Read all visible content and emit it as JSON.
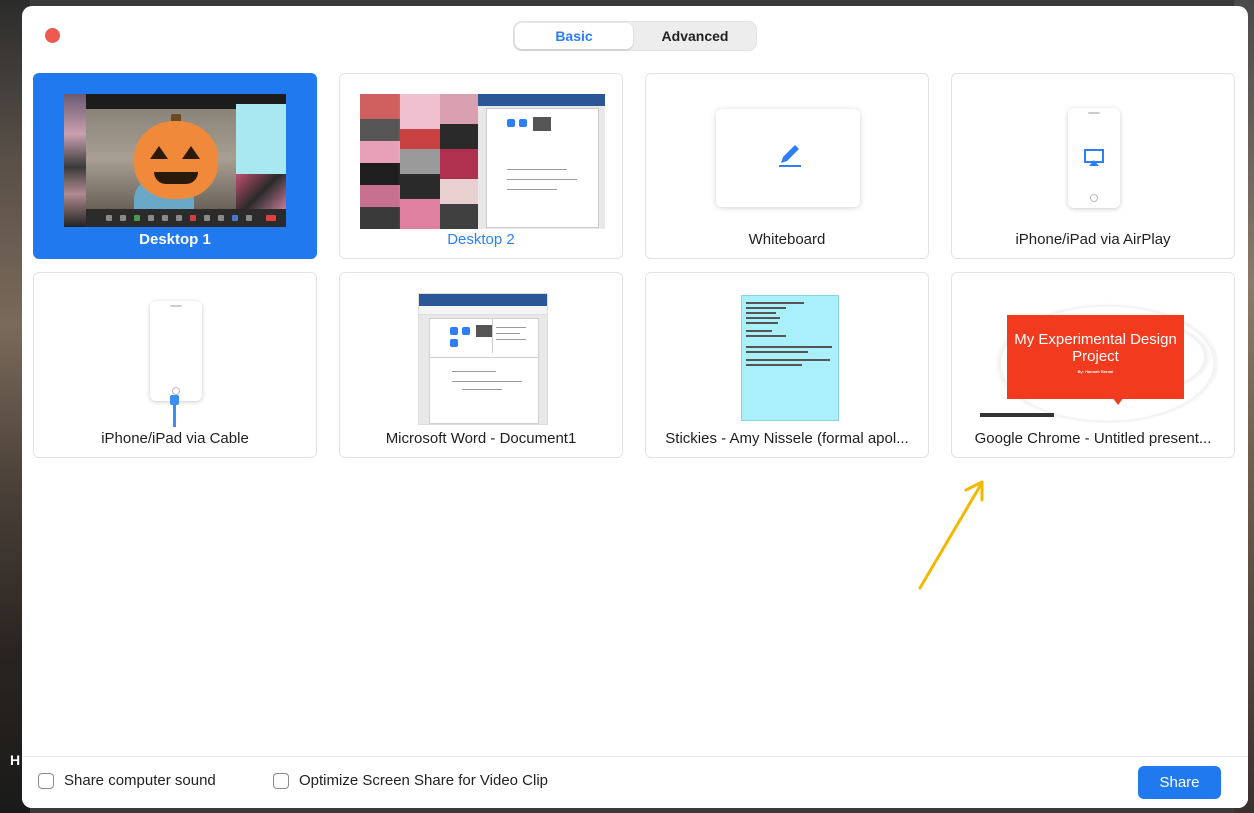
{
  "tabs": {
    "basic": "Basic",
    "advanced": "Advanced",
    "active": "basic"
  },
  "tiles": [
    {
      "label": "Desktop 1"
    },
    {
      "label": "Desktop 2"
    },
    {
      "label": "Whiteboard"
    },
    {
      "label": "iPhone/iPad via AirPlay"
    },
    {
      "label": "iPhone/iPad via Cable"
    },
    {
      "label": "Microsoft Word - Document1"
    },
    {
      "label": "Stickies - Amy Nissele (formal apol..."
    },
    {
      "label": "Google Chrome - Untitled present..."
    }
  ],
  "slide": {
    "title": "My Experimental Design Project",
    "byline": "By: Hannah Bernal"
  },
  "footer": {
    "share_sound": "Share computer sound",
    "optimize": "Optimize Screen Share for Video Clip",
    "share_button": "Share"
  },
  "background_letter": "H",
  "colors": {
    "accent": "#2179ef",
    "close": "#ee5a52",
    "arrow": "#f5b800",
    "slide_red": "#f23a1f"
  },
  "icons": [
    "close-icon",
    "pencil-icon",
    "airplay-icon",
    "checkbox-icon",
    "arrow-icon"
  ]
}
